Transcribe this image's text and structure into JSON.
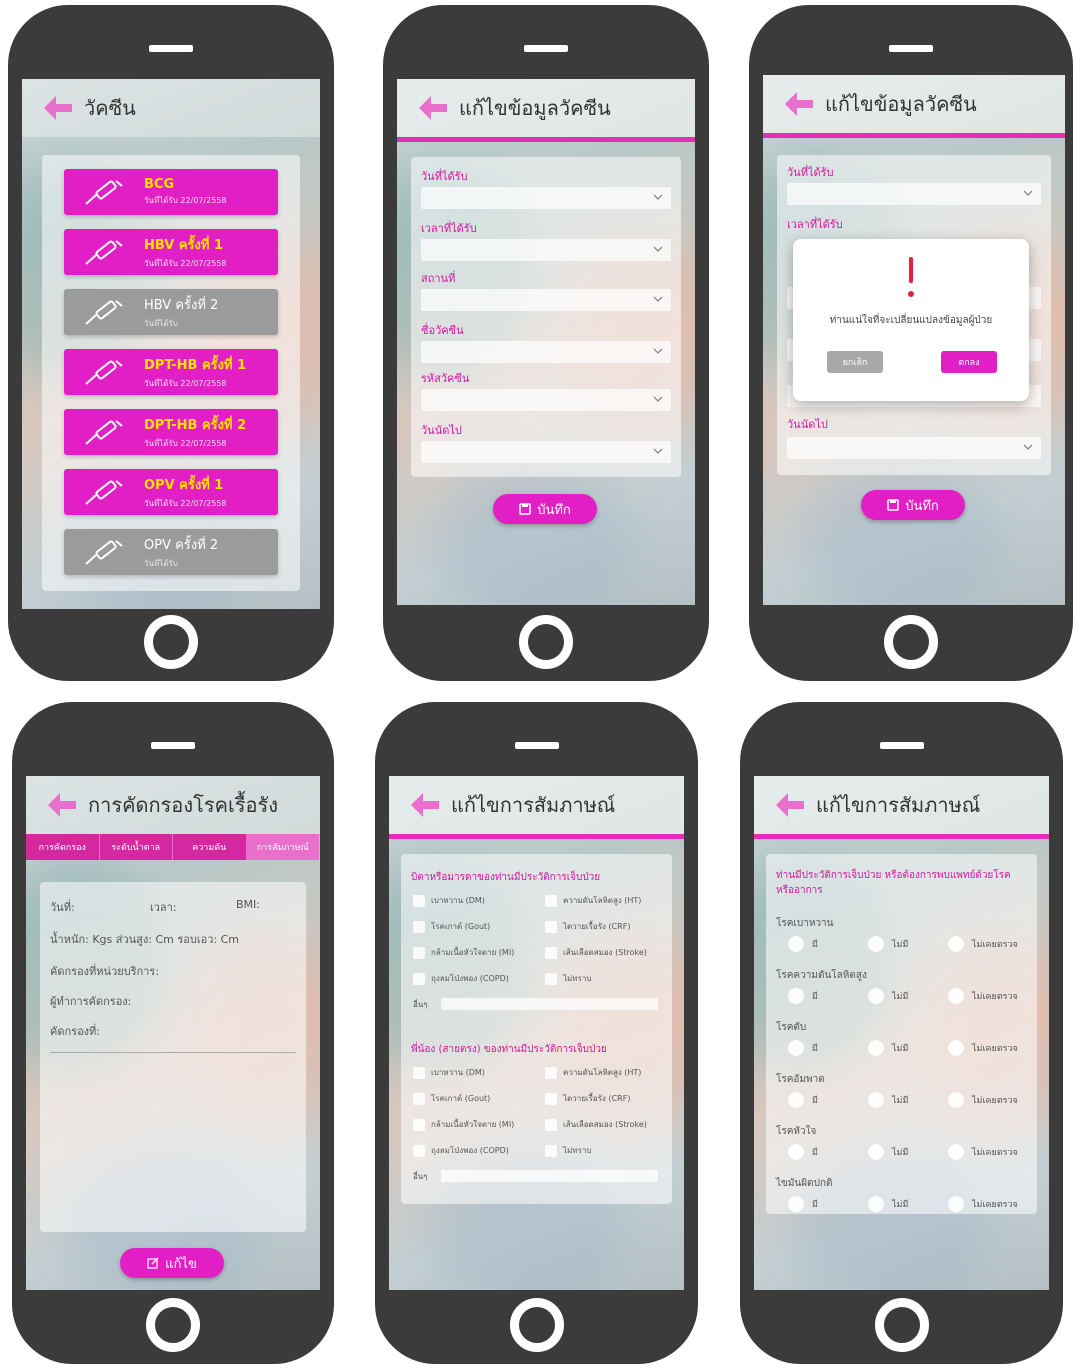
{
  "s1": {
    "title": "วัคซีน",
    "items": [
      {
        "name": "BCG",
        "sub": "วันที่ได้รับ 22/07/2558",
        "status": "done"
      },
      {
        "name": "HBV ครั้งที่ 1",
        "sub": "วันที่ได้รับ 22/07/2558",
        "status": "done"
      },
      {
        "name": "HBV ครั้งที่ 2",
        "sub": "วันที่ได้รับ",
        "status": "pending"
      },
      {
        "name": "DPT-HB ครั้งที่ 1",
        "sub": "วันที่ได้รับ 22/07/2558",
        "status": "done"
      },
      {
        "name": "DPT-HB ครั้งที่ 2",
        "sub": "วันที่ได้รับ 22/07/2558",
        "status": "done"
      },
      {
        "name": "OPV ครั้งที่ 1",
        "sub": "วันที่ได้รับ 22/07/2558",
        "status": "done"
      },
      {
        "name": "OPV ครั้งที่ 2",
        "sub": "วันที่ได้รับ",
        "status": "pending"
      }
    ]
  },
  "s2": {
    "title": "แก้ไขข้อมูลวัคซีน",
    "fields": [
      "วันที่ได้รับ",
      "เวลาที่ได้รับ",
      "สถานที่",
      "ชื่อวัคซีน",
      "รหัสวัคซีน",
      "วันนัดไป"
    ],
    "save_label": "บันทึก"
  },
  "s3": {
    "title": "แก้ไขข้อมูลวัคซีน",
    "fields": [
      "วันที่ได้รับ",
      "เวลาที่ได้รับ",
      "วันนัดไป"
    ],
    "save_label": "บันทึก",
    "dialog": {
      "message": "ท่านแน่ใจที่จะเปลี่ยนแปลงข้อมูลผู้ป่วย",
      "cancel": "ยกเลิก",
      "ok": "ตกลง"
    }
  },
  "s4": {
    "title": "การคัดกรองโรคเรื้อรัง",
    "tabs": [
      "การคัดกรอง",
      "ระดับน้ำตาล",
      "ความดัน",
      "การสัมภาษณ์"
    ],
    "date_label": "วันที่:",
    "time_label": "เวลา:",
    "bmi_label": "BMI:",
    "measure_line": "น้ำหนัก: Kgs ส่วนสูง: Cm รอบเอว: Cm",
    "unit_label": "คัดกรองที่หน่วยบริการ:",
    "screener_label": "ผู้ทำการคัดกรอง:",
    "screen_no_label": "คัดกรองที่:",
    "edit_label": "แก้ไข"
  },
  "s5": {
    "title": "แก้ไขการสัมภาษณ์",
    "section1": "บิดาหรือมารดาของท่านมีประวัติการเจ็บป่วย",
    "section2": "พี่น้อง (สายตรง) ของท่านมีประวัติการเจ็บป่วย",
    "options": [
      "เบาหวาน (DM)",
      "ความดันโลหิตสูง (HT)",
      "โรคเกาต์ (Gout)",
      "ไตวายเรื้อรัง (CRF)",
      "กล้ามเนื้อหัวใจตาย (MI)",
      "เส้นเลือดสมอง (Stroke)",
      "ถุงลมโป่งพอง (COPD)",
      "ไม่ทราบ"
    ],
    "other_label": "อื่นๆ"
  },
  "s6": {
    "title": "แก้ไขการสัมภาษณ์",
    "question": "ท่านมีประวัติการเจ็บป่วย หรือต้องการพบแพทย์ด้วยโรค หรืออาการ",
    "conditions": [
      "โรคเบาหวาน",
      "โรคความดันโลหิตสูง",
      "โรคตับ",
      "โรคอัมพาต",
      "โรคหัวใจ",
      "ไขมันผิดปกติ"
    ],
    "choices": [
      "มี",
      "ไม่มี",
      "ไม่เคยตรวจ"
    ]
  },
  "colors": {
    "accent": "#e21fc4",
    "pending": "#9b9b9b",
    "label": "#d0179f",
    "frame": "#3b3b3b"
  }
}
